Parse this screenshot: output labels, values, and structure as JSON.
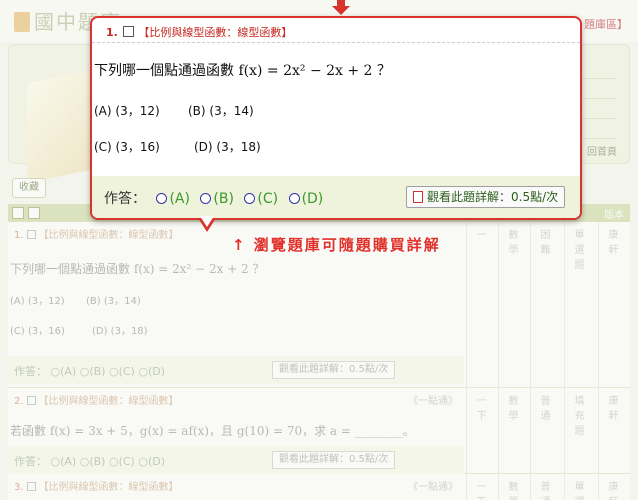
{
  "site": {
    "logo_text": "國中題庫",
    "region_label": "題庫區】",
    "back_home": "回首頁",
    "collect_label": "收藏",
    "version_header": "版本"
  },
  "popup": {
    "number": "1.",
    "category": "【比例與線型函數：線型函數】",
    "question": "下列哪一個點通過函數 f(x) = 2x² − 2x + 2 ？",
    "options": [
      "(A) (3，12)",
      "(B) (3，14)",
      "(C) (3，16)",
      "(D) (3，18)"
    ],
    "answer_label": "作答：",
    "answer_choices": [
      "(A)",
      "(B)",
      "(C)",
      "(D)"
    ],
    "buy_label": "觀看此題詳解：0.5點/次"
  },
  "callout": "↑ 瀏覽題庫可隨題購買詳解",
  "questions": [
    {
      "number": "1.",
      "category": "【比例與線型函數：線型函數】",
      "tag": "",
      "text": "下列哪一個點通過函數 f(x) = 2x² − 2x + 2 ？",
      "options": [
        "(A) (3，12)",
        "(B) (3，14)",
        "(C) (3，16)",
        "(D) (3，18)"
      ],
      "answer_label": "作答：",
      "answer_choices": [
        "(A)",
        "(B)",
        "(C)",
        "(D)"
      ],
      "buy_label": "觀看此題詳解：0.5點/次",
      "meta": [
        "一",
        "數學",
        "困難",
        "單選題",
        "康軒"
      ]
    },
    {
      "number": "2.",
      "category": "【比例與線型函數：線型函數】",
      "tag": "《一點通》",
      "text": "若函數 f(x) = 3x + 5，g(x) = af(x)，且 g(10) = 70，求 a = ________。",
      "options": [],
      "answer_label": "作答：",
      "answer_choices": [
        "(A)",
        "(B)",
        "(C)",
        "(D)"
      ],
      "buy_label": "觀看此題詳解：0.5點/次",
      "meta": [
        "一下",
        "數學",
        "普通",
        "填充題",
        "康軒"
      ]
    },
    {
      "number": "3.",
      "category": "【比例與線型函數：線型函數】",
      "tag": "《一點通》",
      "meta": [
        "一下",
        "數學",
        "普通",
        "單選",
        "康軒"
      ]
    }
  ]
}
